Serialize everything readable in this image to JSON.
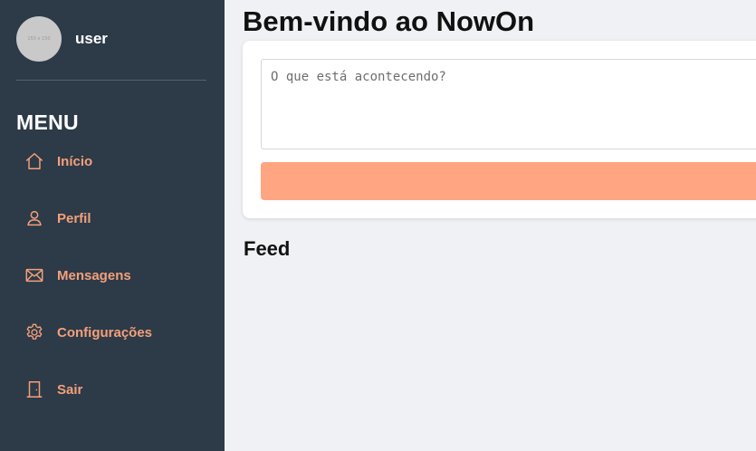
{
  "sidebar": {
    "user": {
      "avatar_text": "150 x 150",
      "name": "user"
    },
    "menu_title": "MENU",
    "items": [
      {
        "label": "Início",
        "icon": "home-icon"
      },
      {
        "label": "Perfil",
        "icon": "user-icon"
      },
      {
        "label": "Mensagens",
        "icon": "envelope-icon"
      },
      {
        "label": "Configurações",
        "icon": "gear-icon"
      },
      {
        "label": "Sair",
        "icon": "door-icon"
      }
    ]
  },
  "main": {
    "title": "Bem-vindo ao NowOn",
    "post": {
      "placeholder": "O que está acontecendo?",
      "value": "",
      "button_label": ""
    },
    "feed_title": "Feed"
  },
  "colors": {
    "sidebar_bg": "#2d3a48",
    "accent": "#f4a07a",
    "button": "#ffa581",
    "page_bg": "#f0f1f5"
  }
}
